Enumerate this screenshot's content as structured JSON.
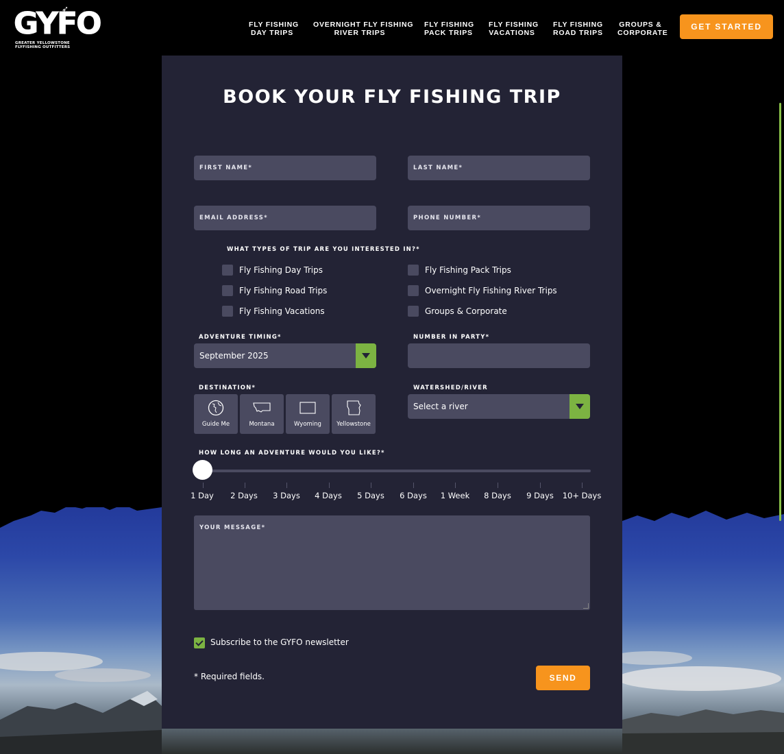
{
  "header": {
    "logo_text": "GYFO",
    "logo_subtitle": "GREATER YELLOWSTONE FLYFISHING OUTFITTERS",
    "nav": [
      {
        "line1": "FLY FISHING",
        "line2": "DAY TRIPS"
      },
      {
        "line1": "OVERNIGHT FLY FISHING",
        "line2": "RIVER TRIPS"
      },
      {
        "line1": "FLY FISHING",
        "line2": "PACK TRIPS"
      },
      {
        "line1": "FLY FISHING",
        "line2": "VACATIONS"
      },
      {
        "line1": "FLY FISHING",
        "line2": "ROAD TRIPS"
      },
      {
        "line1": "GROUPS &",
        "line2": "CORPORATE"
      }
    ],
    "cta_label": "GET STARTED"
  },
  "form": {
    "title": "BOOK YOUR FLY FISHING TRIP",
    "first_name_placeholder": "FIRST NAME*",
    "last_name_placeholder": "LAST NAME*",
    "email_placeholder": "EMAIL ADDRESS*",
    "phone_placeholder": "PHONE NUMBER*",
    "trip_types_label": "WHAT TYPES OF TRIP ARE YOU INTERESTED IN?*",
    "trip_types": [
      {
        "label": "Fly Fishing Day Trips",
        "checked": false
      },
      {
        "label": "Fly Fishing Road Trips",
        "checked": false
      },
      {
        "label": "Fly Fishing Vacations",
        "checked": false
      },
      {
        "label": "Fly Fishing Pack Trips",
        "checked": false
      },
      {
        "label": "Overnight Fly Fishing River Trips",
        "checked": false
      },
      {
        "label": "Groups & Corporate",
        "checked": false
      }
    ],
    "timing_label": "ADVENTURE TIMING*",
    "timing_value": "September 2025",
    "party_label": "NUMBER IN PARTY*",
    "party_value": "",
    "destination_label": "DESTINATION*",
    "destinations": [
      "Guide Me",
      "Montana",
      "Wyoming",
      "Yellowstone"
    ],
    "watershed_label": "WATERSHED/RIVER",
    "watershed_value": "Select a river",
    "duration_label": "HOW LONG AN ADVENTURE WOULD YOU LIKE?*",
    "duration_options": [
      "1 Day",
      "2 Days",
      "3 Days",
      "4 Days",
      "5 Days",
      "6 Days",
      "1 Week",
      "8 Days",
      "9 Days",
      "10+ Days"
    ],
    "duration_selected_index": 0,
    "message_placeholder": "YOUR MESSAGE*",
    "newsletter_label": "Subscribe to the GYFO newsletter",
    "newsletter_checked": true,
    "required_note": "* Required fields.",
    "send_label": "SEND"
  },
  "colors": {
    "accent_orange": "#f7941d",
    "accent_green": "#7cb342",
    "panel_bg": "#232335",
    "field_bg": "#4a4a60"
  }
}
